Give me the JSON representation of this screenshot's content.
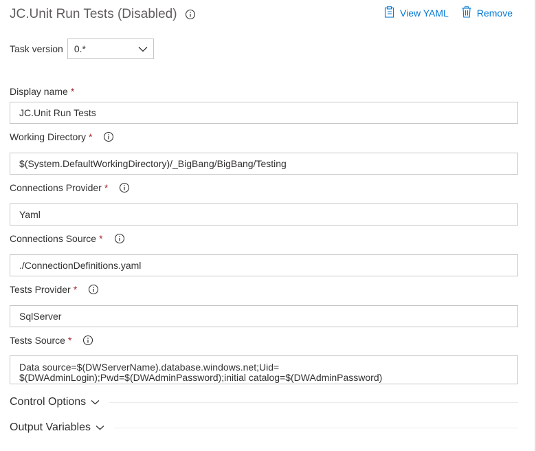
{
  "header": {
    "title": "JC.Unit Run Tests (Disabled)",
    "view_yaml": "View YAML",
    "remove": "Remove"
  },
  "task_version": {
    "label": "Task version",
    "value": "0.*"
  },
  "fields": {
    "display_name": {
      "label": "Display name",
      "required": "*",
      "value": "JC.Unit Run Tests"
    },
    "working_directory": {
      "label": "Working Directory",
      "required": "*",
      "value": "$(System.DefaultWorkingDirectory)/_BigBang/BigBang/Testing"
    },
    "connections_provider": {
      "label": "Connections Provider",
      "required": "*",
      "value": "Yaml"
    },
    "connections_source": {
      "label": "Connections Source",
      "required": "*",
      "value": "./ConnectionDefinitions.yaml"
    },
    "tests_provider": {
      "label": "Tests Provider",
      "required": "*",
      "value": "SqlServer"
    },
    "tests_source": {
      "label": "Tests Source",
      "required": "*",
      "value": "Data source=$(DWServerName).database.windows.net;Uid= $(DWAdminLogin);Pwd=$(DWAdminPassword);initial catalog=$(DWAdminPassword)"
    }
  },
  "sections": {
    "control_options": "Control Options",
    "output_variables": "Output Variables"
  },
  "colors": {
    "accent": "#0078d4",
    "required": "#a4262c",
    "border": "#c8c6c4"
  },
  "icons": [
    "info-icon",
    "clipboard-icon",
    "trash-icon",
    "chevron-down-icon"
  ]
}
